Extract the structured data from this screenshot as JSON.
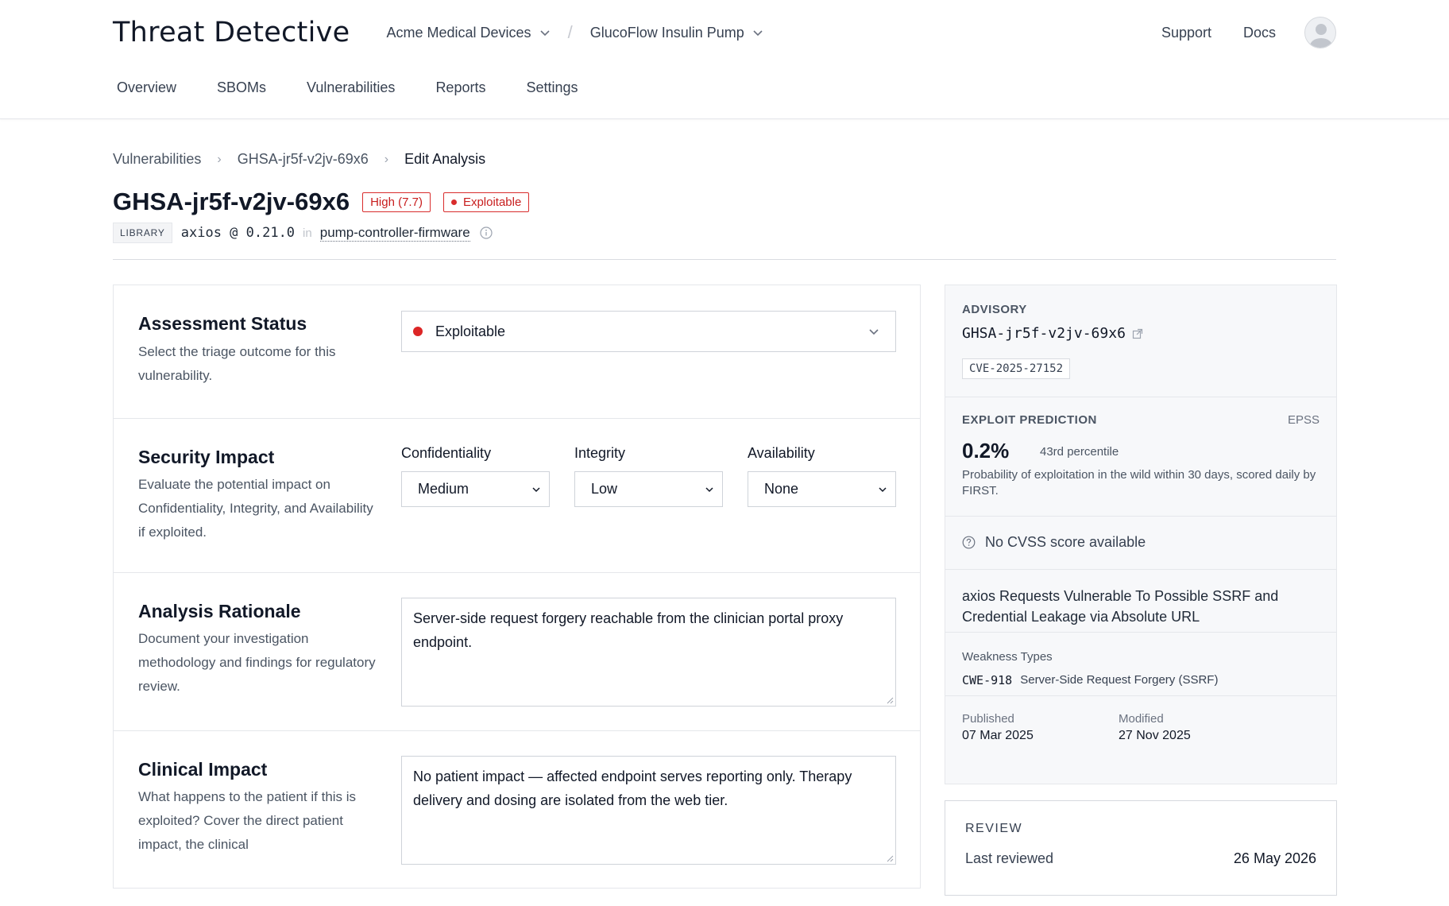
{
  "header": {
    "logo": "Threat Detective",
    "org": "Acme Medical Devices",
    "product": "GlucoFlow Insulin Pump",
    "links": [
      "Support",
      "Docs"
    ]
  },
  "tabs": [
    "Overview",
    "SBOMs",
    "Vulnerabilities",
    "Reports",
    "Settings"
  ],
  "breadcrumb": [
    "Vulnerabilities",
    "GHSA-jr5f-v2jv-69x6",
    "Edit Analysis"
  ],
  "vuln": {
    "id": "GHSA-jr5f-v2jv-69x6",
    "severity": "High (7.7)",
    "status_badge": "Exploitable",
    "type_tag": "LIBRARY",
    "package": "axios @ 0.21.0",
    "in_label": "in",
    "component": "pump-controller-firmware"
  },
  "form": {
    "assessment": {
      "title": "Assessment Status",
      "desc": "Select the triage outcome for this vulnerability.",
      "value": "Exploitable"
    },
    "impact": {
      "title": "Security Impact",
      "desc": "Evaluate the potential impact on Confidentiality, Integrity, and Availability if exploited.",
      "confidentiality_label": "Confidentiality",
      "confidentiality": "Medium",
      "integrity_label": "Integrity",
      "integrity": "Low",
      "availability_label": "Availability",
      "availability": "None"
    },
    "rationale": {
      "title": "Analysis Rationale",
      "desc": "Document your investigation methodology and findings for regulatory review.",
      "value": "Server-side request forgery reachable from the clinician portal proxy endpoint."
    },
    "clinical": {
      "title": "Clinical Impact",
      "desc": "What happens to the patient if this is exploited? Cover the direct patient impact, the clinical",
      "value": "No patient impact — affected endpoint serves reporting only. Therapy delivery and dosing are isolated from the web tier."
    }
  },
  "side": {
    "advisory_cap": "ADVISORY",
    "advisory_id": "GHSA-jr5f-v2jv-69x6",
    "cve": "CVE-2025-27152",
    "exploit_cap": "EXPLOIT PREDICTION",
    "epss": "EPSS",
    "epss_value": "0.2%",
    "percentile": "43rd percentile",
    "epss_desc": "Probability of exploitation in the wild within 30 days, scored daily by FIRST.",
    "no_cvss": "No CVSS score available",
    "advisory_title": "axios Requests Vulnerable To Possible SSRF and Credential Leakage via Absolute URL",
    "weakness_label": "Weakness Types",
    "cwe": "CWE-918",
    "cwe_name": "Server-Side Request Forgery (SSRF)",
    "published_label": "Published",
    "published": "07 Mar 2025",
    "modified_label": "Modified",
    "modified": "27 Nov 2025"
  },
  "review": {
    "cap": "REVIEW",
    "last_label": "Last reviewed",
    "last_value": "26 May 2026"
  },
  "colors": {
    "danger": "#dc2626",
    "accent_dot": "#e0a91f"
  }
}
